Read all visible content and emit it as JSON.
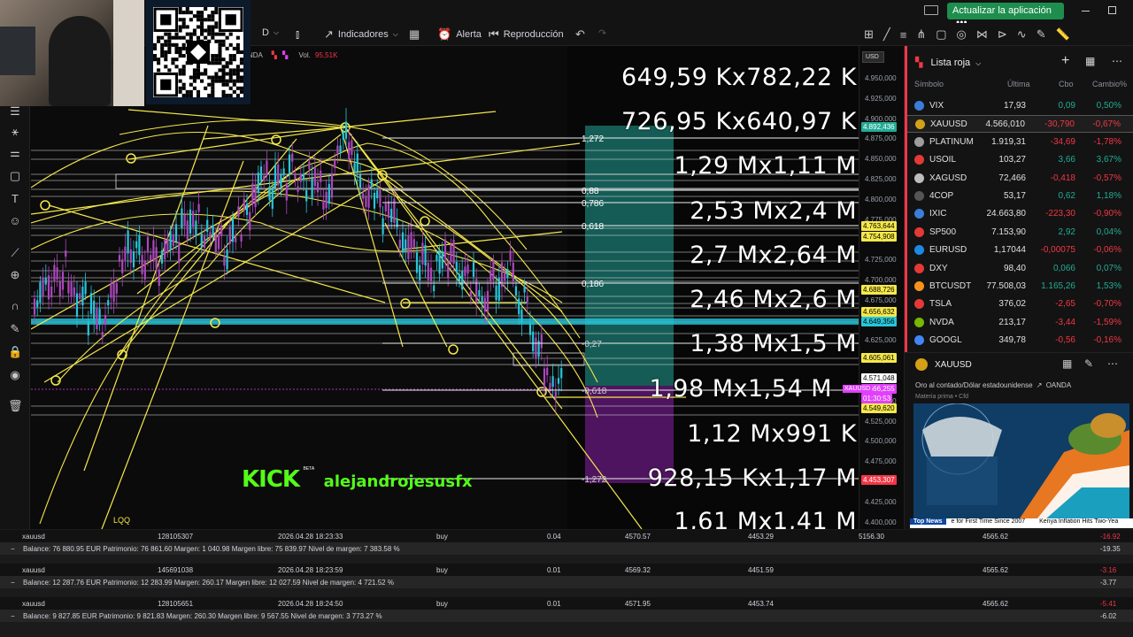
{
  "top_bar": {
    "update_button": "Actualizar la aplicación",
    "dots": "●●●"
  },
  "toolbar": {
    "timeframe": "D",
    "indicators": "Indicadores",
    "alert": "Alerta",
    "replay": "Reproducción"
  },
  "chart": {
    "broker_fragment": "NDA",
    "volume_label": "Vol.",
    "volume_value": "95,51K",
    "currency": "USD",
    "bottom_label": "LQQ",
    "fib_levels": [
      "1,272",
      "0,88",
      "0,786",
      "0,618",
      "0,186",
      "-0,27",
      "-0,618",
      "-1,272"
    ],
    "stream_brand": "KICK",
    "stream_brand_sup": "BETA",
    "stream_user": "alejandrojesusfx"
  },
  "overlay_volumes": [
    "649,59 Kx782,22 K",
    "726,95 Kx640,97 K",
    "1,29 Mx1,11 M",
    "2,53 Mx2,4 M",
    "2,7 Mx2,64 M",
    "2,46 Mx2,6 M",
    "1,38 Mx1,5 M",
    "1,98 Mx1,54 M",
    "1,12 Mx991 K",
    "928,15 Kx1,17 M",
    "1,61 Mx1,41 M"
  ],
  "price_scale": {
    "labels": [
      "4.950,000",
      "4.925,000",
      "4.900,000",
      "4.875,000",
      "4.850,000",
      "4.825,000",
      "4.800,000",
      "4.775,000",
      "4.750,000",
      "4.725,000",
      "4.700,000",
      "4.675,000",
      "4.650,000",
      "4.625,000",
      "4.600,000",
      "4.575,000",
      "4.550,000",
      "4.525,000",
      "4.500,000",
      "4.475,000",
      "4.450,000",
      "4.425,000",
      "4.400,000"
    ],
    "tags": [
      {
        "text": "4.892,436",
        "color": "#22ab94"
      },
      {
        "text": "4.763,644",
        "color": "#f5e84a"
      },
      {
        "text": "4.754,908",
        "color": "#f5e84a"
      },
      {
        "text": "4.688,726",
        "color": "#f5e84a"
      },
      {
        "text": "4.656,632",
        "color": "#f5e84a"
      },
      {
        "text": "4.649,356",
        "color": "#26c6da"
      },
      {
        "text": "4.605,061",
        "color": "#f5e84a"
      },
      {
        "text": "4.571,048",
        "color": "#ffffff"
      },
      {
        "text": "4.566,255",
        "color": "#e040fb"
      },
      {
        "text": "01:30:53",
        "color": "#e040fb"
      },
      {
        "text": "4.549,620",
        "color": "#f5e84a"
      },
      {
        "text": "4.453,307",
        "color": "#f23645"
      }
    ],
    "symbol_tag": "XAUUSD"
  },
  "watchlist": {
    "title": "Lista roja",
    "columns": [
      "Símbolo",
      "Última",
      "Cbo",
      "Cambio%"
    ],
    "rows": [
      {
        "symbol": "VIX",
        "last": "17,93",
        "chg": "0,09",
        "pct": "0,50%",
        "dir": "pos",
        "color": "#3b7dd8"
      },
      {
        "symbol": "XAUUSD",
        "last": "4.566,010",
        "chg": "-30,790",
        "pct": "-0,67%",
        "dir": "neg",
        "color": "#d4a017"
      },
      {
        "symbol": "PLATINUM",
        "last": "1.919,31",
        "chg": "-34,69",
        "pct": "-1,78%",
        "dir": "neg",
        "color": "#9e9e9e"
      },
      {
        "symbol": "USOIL",
        "last": "103,27",
        "chg": "3,66",
        "pct": "3,67%",
        "dir": "pos",
        "color": "#e53935"
      },
      {
        "symbol": "XAGUSD",
        "last": "72,466",
        "chg": "-0,418",
        "pct": "-0,57%",
        "dir": "neg",
        "color": "#bdbdbd"
      },
      {
        "symbol": "4COP",
        "last": "53,17",
        "chg": "0,62",
        "pct": "1,18%",
        "dir": "pos",
        "color": "#555"
      },
      {
        "symbol": "IXIC",
        "last": "24.663,80",
        "chg": "-223,30",
        "pct": "-0,90%",
        "dir": "neg",
        "color": "#3b7dd8"
      },
      {
        "symbol": "SP500",
        "last": "7.153,90",
        "chg": "2,92",
        "pct": "0,04%",
        "dir": "pos",
        "color": "#e53935"
      },
      {
        "symbol": "EURUSD",
        "last": "1,17044",
        "chg": "-0,00075",
        "pct": "-0,06%",
        "dir": "neg",
        "color": "#1e88e5"
      },
      {
        "symbol": "DXY",
        "last": "98,40",
        "chg": "0,066",
        "pct": "0,07%",
        "dir": "pos",
        "color": "#e53935"
      },
      {
        "symbol": "BTCUSDT",
        "last": "77.508,03",
        "chg": "1.165,26",
        "pct": "1,53%",
        "dir": "pos",
        "color": "#f7931a"
      },
      {
        "symbol": "TSLA",
        "last": "376,02",
        "chg": "-2,65",
        "pct": "-0,70%",
        "dir": "neg",
        "color": "#e53935"
      },
      {
        "symbol": "NVDA",
        "last": "213,17",
        "chg": "-3,44",
        "pct": "-1,59%",
        "dir": "neg",
        "color": "#76b900"
      },
      {
        "symbol": "GOOGL",
        "last": "349,78",
        "chg": "-0,56",
        "pct": "-0,16%",
        "dir": "neg",
        "color": "#4285f4"
      }
    ]
  },
  "detail": {
    "symbol": "XAUUSD",
    "description": "Oro al contado/Dólar estadounidense",
    "broker": "OANDA",
    "category": "Materia prima",
    "type": "Cfd",
    "ticker_label": "Top News",
    "ticker_text1": "e for First Time Since 2007",
    "ticker_text2": "Kenya Inflation Hits Two-Yea"
  },
  "orders": [
    {
      "symbol": "xauusd",
      "ticket": "128105307",
      "time": "2026.04.28 18:23:33",
      "side": "buy",
      "lots": "0.04",
      "tp": "4570.57",
      "sl": "4453.29",
      "col8": "5156.30",
      "current": "4565.62",
      "profit": "-16.92",
      "balance": "Balance: 76 880.95 EUR  Patrimonio: 76 861.60  Margen: 1 040.98  Margen libre: 75 839.97  Nivel de margen: 7 383.58 %",
      "total": "-19.35"
    },
    {
      "symbol": "xauusd",
      "ticket": "145691038",
      "time": "2026.04.28 18:23:59",
      "side": "buy",
      "lots": "0.01",
      "tp": "4569.32",
      "sl": "4451.59",
      "col8": "",
      "current": "4565.62",
      "profit": "-3.16",
      "balance": "Balance: 12 287.76 EUR  Patrimonio: 12 283.99  Margen: 260.17  Margen libre: 12 027.59  Nivel de margen: 4 721.52 %",
      "total": "-3.77"
    },
    {
      "symbol": "xauusd",
      "ticket": "128105651",
      "time": "2026.04.28 18:24:50",
      "side": "buy",
      "lots": "0.01",
      "tp": "4571.95",
      "sl": "4453.74",
      "col8": "",
      "current": "4565.62",
      "profit": "-5.41",
      "balance": "Balance: 9 827.85 EUR  Patrimonio: 9 821.83  Margen: 260.30  Margen libre: 9 567.55  Nivel de margen: 3 773.27 %",
      "total": "-6.02"
    }
  ]
}
